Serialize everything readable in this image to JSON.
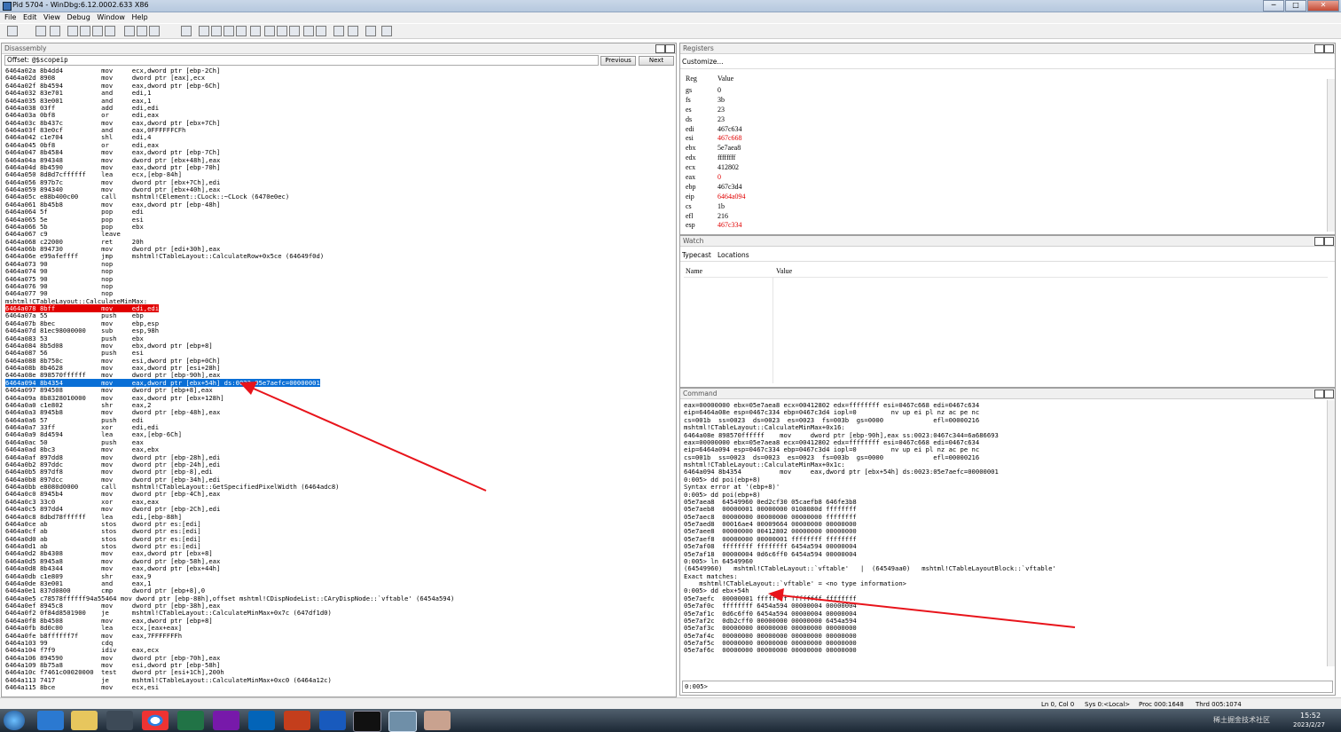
{
  "window": {
    "title": "Pid 5704 - WinDbg:6.12.0002.633 X86",
    "min": "─",
    "max": "□",
    "close": "✕"
  },
  "menu": [
    "File",
    "Edit",
    "View",
    "Debug",
    "Window",
    "Help"
  ],
  "disassembly": {
    "title": "Disassembly",
    "offset_label": "Offset:",
    "offset_value": "@$scopeip",
    "previous": "Previous",
    "next": "Next",
    "lines": [
      "6464a02a 8b4dd4          mov     ecx,dword ptr [ebp-2Ch]",
      "6464a02d 8908            mov     dword ptr [eax],ecx",
      "6464a02f 8b4594          mov     eax,dword ptr [ebp-6Ch]",
      "6464a032 83e701          and     edi,1",
      "6464a035 83e001          and     eax,1",
      "6464a038 03ff            add     edi,edi",
      "6464a03a 0bf8            or      edi,eax",
      "6464a03c 8b437c          mov     eax,dword ptr [ebx+7Ch]",
      "6464a03f 83e0cf          and     eax,0FFFFFFCFh",
      "6464a042 c1e704          shl     edi,4",
      "6464a045 0bf8            or      edi,eax",
      "6464a047 8b4584          mov     eax,dword ptr [ebp-7Ch]",
      "6464a04a 894348          mov     dword ptr [ebx+48h],eax",
      "6464a04d 8b4590          mov     eax,dword ptr [ebp-70h]",
      "6464a050 8d8d7cffffff    lea     ecx,[ebp-84h]",
      "6464a056 897b7c          mov     dword ptr [ebx+7Ch],edi",
      "6464a059 894340          mov     dword ptr [ebx+40h],eax",
      "6464a05c e88b400c00      call    mshtml!CElement::CLock::~CLock (6470e0ec)",
      "6464a061 8b45b8          mov     eax,dword ptr [ebp-48h]",
      "6464a064 5f              pop     edi",
      "6464a065 5e              pop     esi",
      "6464a066 5b              pop     ebx",
      "6464a067 c9              leave",
      "6464a068 c22000          ret     20h",
      "6464a06b 894730          mov     dword ptr [edi+30h],eax",
      "6464a06e e99afeffff      jmp     mshtml!CTableLayout::CalculateRow+0x5ce (64649f0d)",
      "6464a073 90              nop",
      "6464a074 90              nop",
      "6464a075 90              nop",
      "6464a076 90              nop",
      "6464a077 90              nop",
      "mshtml!CTableLayout::CalculateMinMax:",
      "6464a078 8bff            mov     edi,edi",
      "6464a07a 55              push    ebp",
      "6464a07b 8bec            mov     ebp,esp",
      "6464a07d 81ec98000000    sub     esp,98h",
      "6464a083 53              push    ebx",
      "6464a084 8b5d08          mov     ebx,dword ptr [ebp+8]",
      "6464a087 56              push    esi",
      "6464a088 8b750c          mov     esi,dword ptr [ebp+0Ch]",
      "6464a08b 8b4628          mov     eax,dword ptr [esi+28h]",
      "6464a08e 898570ffffff    mov     dword ptr [ebp-90h],eax",
      "6464a094 8b4354          mov     eax,dword ptr [ebx+54h] ds:0023:05e7aefc=00000001",
      "6464a097 894508          mov     dword ptr [ebp+8],eax",
      "6464a09a 8b8328010000    mov     eax,dword ptr [ebx+128h]",
      "6464a0a0 c1e802          shr     eax,2",
      "6464a0a3 8945b8          mov     dword ptr [ebp-48h],eax",
      "6464a0a6 57              push    edi",
      "6464a0a7 33ff            xor     edi,edi",
      "6464a0a9 8d4594          lea     eax,[ebp-6Ch]",
      "6464a0ac 50              push    eax",
      "6464a0ad 8bc3            mov     eax,ebx",
      "6464a0af 897dd8          mov     dword ptr [ebp-28h],edi",
      "6464a0b2 897ddc          mov     dword ptr [ebp-24h],edi",
      "6464a0b5 897df8          mov     dword ptr [ebp-8],edi",
      "6464a0b8 897dcc          mov     dword ptr [ebp-34h],edi",
      "6464a0bb e8080d0000      call    mshtml!CTableLayout::GetSpecifiedPixelWidth (6464adc8)",
      "6464a0c0 8945b4          mov     dword ptr [ebp-4Ch],eax",
      "6464a0c3 33c0            xor     eax,eax",
      "6464a0c5 897dd4          mov     dword ptr [ebp-2Ch],edi",
      "6464a0c8 8dbd78ffffff    lea     edi,[ebp-88h]",
      "6464a0ce ab              stos    dword ptr es:[edi]",
      "6464a0cf ab              stos    dword ptr es:[edi]",
      "6464a0d0 ab              stos    dword ptr es:[edi]",
      "6464a0d1 ab              stos    dword ptr es:[edi]",
      "6464a0d2 8b4308          mov     eax,dword ptr [ebx+8]",
      "6464a0d5 8945a8          mov     dword ptr [ebp-58h],eax",
      "6464a0d8 8b4344          mov     eax,dword ptr [ebx+44h]",
      "6464a0db c1e809          shr     eax,9",
      "6464a0de 83e001          and     eax,1",
      "6464a0e1 837d0800        cmp     dword ptr [ebp+8],0",
      "6464a0e5 c78578ffffff94a55464 mov dword ptr [ebp-88h],offset mshtml!CDispNodeList::CAryDispNode::`vftable' (6454a594)",
      "6464a0ef 8945c8          mov     dword ptr [ebp-38h],eax",
      "6464a0f2 0f84d8501900    je      mshtml!CTableLayout::CalculateMinMax+0x7c (647df1d0)",
      "6464a0f8 8b4508          mov     eax,dword ptr [ebp+8]",
      "6464a0fb 8d0c00          lea     ecx,[eax+eax]",
      "6464a0fe b8ffffff7f      mov     eax,7FFFFFFFh",
      "6464a103 99              cdq",
      "6464a104 f7f9            idiv    eax,ecx",
      "6464a106 894590          mov     dword ptr [ebp-70h],eax",
      "6464a109 8b75a8          mov     esi,dword ptr [ebp-58h]",
      "6464a10c f7461c00020000  test    dword ptr [esi+1Ch],200h",
      "6464a113 7417            je      mshtml!CTableLayout::CalculateMinMax+0xc0 (6464a12c)",
      "6464a115 8bce            mov     ecx,esi"
    ]
  },
  "registers": {
    "title": "Registers",
    "customize": "Customize...",
    "col_reg": "Reg",
    "col_value": "Value",
    "rows": [
      {
        "reg": "gs",
        "value": "0",
        "changed": false
      },
      {
        "reg": "fs",
        "value": "3b",
        "changed": false
      },
      {
        "reg": "es",
        "value": "23",
        "changed": false
      },
      {
        "reg": "ds",
        "value": "23",
        "changed": false
      },
      {
        "reg": "edi",
        "value": "467c634",
        "changed": false
      },
      {
        "reg": "esi",
        "value": "467c668",
        "changed": true
      },
      {
        "reg": "ebx",
        "value": "5e7aea8",
        "changed": false
      },
      {
        "reg": "edx",
        "value": "ffffffff",
        "changed": false
      },
      {
        "reg": "ecx",
        "value": "412802",
        "changed": false
      },
      {
        "reg": "eax",
        "value": "0",
        "changed": true
      },
      {
        "reg": "ebp",
        "value": "467c3d4",
        "changed": false
      },
      {
        "reg": "eip",
        "value": "6464a094",
        "changed": true
      },
      {
        "reg": "cs",
        "value": "1b",
        "changed": false
      },
      {
        "reg": "efl",
        "value": "216",
        "changed": false
      },
      {
        "reg": "esp",
        "value": "467c334",
        "changed": true
      }
    ]
  },
  "watch": {
    "title": "Watch",
    "tab_typecast": "Typecast",
    "tab_locations": "Locations",
    "col_name": "Name",
    "col_value": "Value"
  },
  "command": {
    "title": "Command",
    "prompt": "0:005>",
    "lines": [
      "eax=00000000 ebx=05e7aea8 ecx=00412802 edx=ffffffff esi=0467c668 edi=0467c634",
      "eip=6464a08e esp=0467c334 ebp=0467c3d4 iopl=0         nv up ei pl nz ac pe nc",
      "cs=001b  ss=0023  ds=0023  es=0023  fs=003b  gs=0000             efl=00000216",
      "mshtml!CTableLayout::CalculateMinMax+0x16:",
      "6464a08e 898570ffffff    mov     dword ptr [ebp-90h],eax ss:0023:0467c344=6a686693",
      "eax=00000000 ebx=05e7aea8 ecx=00412802 edx=ffffffff esi=0467c668 edi=0467c634",
      "eip=6464a094 esp=0467c334 ebp=0467c3d4 iopl=0         nv up ei pl nz ac pe nc",
      "cs=001b  ss=0023  ds=0023  es=0023  fs=003b  gs=0000             efl=00000216",
      "mshtml!CTableLayout::CalculateMinMax+0x1c:",
      "6464a094 8b4354          mov     eax,dword ptr [ebx+54h] ds:0023:05e7aefc=00000001",
      "0:005> dd poi(ebp+8)",
      "Syntax error at '(ebp+8)'",
      "0:005> dd poi(ebp+8)",
      "05e7aea8  64549960 0ed2cf30 05caefb8 646fe3b8",
      "05e7aeb8  00000001 00000000 0108080d ffffffff",
      "05e7aec8  00000000 00000000 00000000 ffffffff",
      "05e7aed8  00016ae4 00009664 00000000 00000000",
      "05e7aee8  00000000 00412802 00000000 00000000",
      "05e7aef8  00000000 00000001 ffffffff ffffffff",
      "05e7af08  ffffffff ffffffff 6454a594 00000004",
      "05e7af18  00000004 0d6c6ff0 6454a594 00000004",
      "0:005> ln 64549960",
      "(64549960)   mshtml!CTableLayout::`vftable'   |  (64549aa0)   mshtml!CTableLayoutBlock::`vftable'",
      "Exact matches:",
      "    mshtml!CTableLayout::`vftable' = <no type information>",
      "0:005> dd ebx+54h",
      "05e7aefc  00000001 ffffffff ffffffff ffffffff",
      "05e7af0c  ffffffff 6454a594 00000004 00000004",
      "05e7af1c  0d6c6ff0 6454a594 00000004 00000004",
      "05e7af2c  0db2cff0 00000000 00000000 6454a594",
      "05e7af3c  00000000 00000000 00000000 00000000",
      "05e7af4c  00000000 00000000 00000000 00000000",
      "05e7af5c  00000000 00000000 00000000 00000000",
      "05e7af6c  00000000 00000000 00000000 00000000"
    ]
  },
  "statusbar": {
    "pos": "Ln 0, Col 0",
    "sys": "Sys 0:<Local>",
    "proc": "Proc 000:1648",
    "thrd": "Thrd 005:1074"
  },
  "taskbar": {
    "time": "15:52",
    "date": "2023/2/27",
    "watermark": "稀土掘金技术社区"
  },
  "colors": {
    "highlight_red": "#e10000",
    "highlight_blue": "#0a6fd6",
    "changed_reg": "#e00000",
    "arrow": "#e8141b"
  }
}
